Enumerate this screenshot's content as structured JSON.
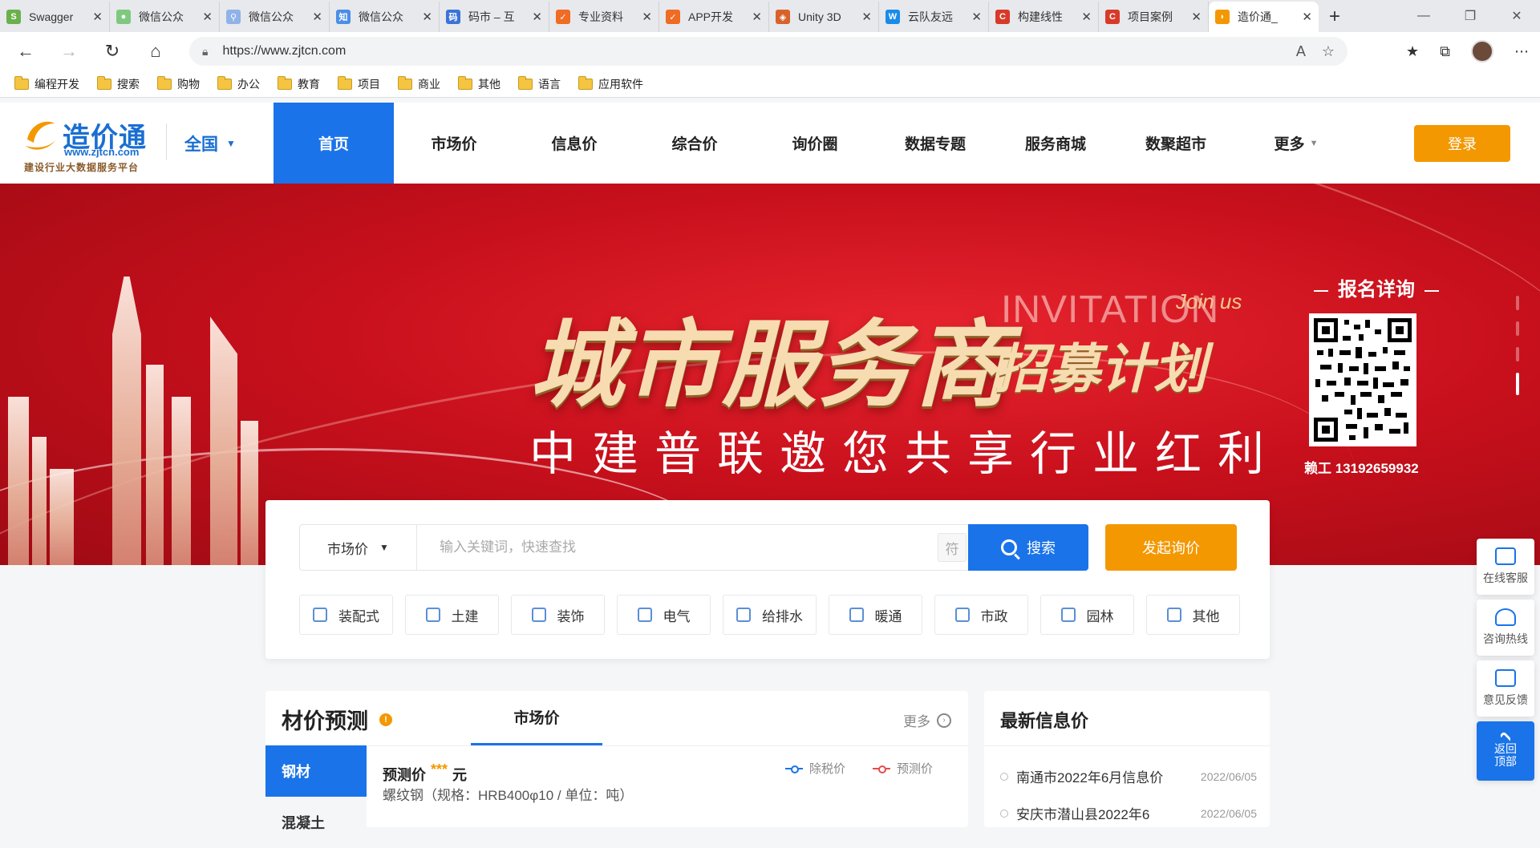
{
  "browser": {
    "tabs": [
      {
        "label": "Swagger",
        "icon": "swagger-icon",
        "color": "#6ab04c"
      },
      {
        "label": "微信公众",
        "icon": "wechat-icon",
        "color": "#7fc97f"
      },
      {
        "label": "微信公众",
        "icon": "search-icon",
        "color": "#8fb3e8"
      },
      {
        "label": "微信公众",
        "icon": "zhihu-icon",
        "color": "#4a8ee8"
      },
      {
        "label": "码市 – 互",
        "icon": "mashi-icon",
        "color": "#3a73d8"
      },
      {
        "label": "专业资料",
        "icon": "check-icon",
        "color": "#f06b24"
      },
      {
        "label": "APP开发",
        "icon": "check-icon",
        "color": "#f06b24"
      },
      {
        "label": "Unity 3D",
        "icon": "unity-icon",
        "color": "#d8622a"
      },
      {
        "label": "云队友远",
        "icon": "yunduiyou-icon",
        "color": "#1a8ce8"
      },
      {
        "label": "构建线性",
        "icon": "csdn-icon",
        "color": "#d83a2a"
      },
      {
        "label": "项目案例",
        "icon": "csdn-icon",
        "color": "#d83a2a"
      },
      {
        "label": "造价通_",
        "icon": "zjtcn-icon",
        "color": "#f39800"
      }
    ],
    "url": "https://www.zjtcn.com",
    "bookmarks": [
      "编程开发",
      "搜索",
      "购物",
      "办公",
      "教育",
      "项目",
      "商业",
      "其他",
      "语言",
      "应用软件"
    ]
  },
  "header": {
    "logo_cn": "造价通",
    "logo_en": "www.zjtcn.com",
    "logo_slogan": "建设行业大数据服务平台",
    "region": "全国",
    "nav": [
      "首页",
      "市场价",
      "信息价",
      "综合价",
      "询价圈",
      "数据专题",
      "服务商城",
      "数聚超市",
      "更多"
    ],
    "login": "登录",
    "accent": "#1a73e8",
    "orange": "#f39800"
  },
  "banner": {
    "title": "城市服务商",
    "invitation": "INVITATION",
    "join": "Join us",
    "plan": "招募计划",
    "subtitle": "中建普联邀您共享行业红利",
    "signup": "报名详询",
    "phone": "赖工 13192659932"
  },
  "search": {
    "type": "市场价",
    "placeholder": "输入关键词，快速查找",
    "symbol": "符",
    "button": "搜索",
    "inquiry": "发起询价",
    "categories": [
      "装配式",
      "土建",
      "装饰",
      "电气",
      "给排水",
      "暖通",
      "市政",
      "园林",
      "其他"
    ]
  },
  "forecast": {
    "title": "材价预测",
    "tab": "市场价",
    "more": "更多",
    "side": [
      "钢材",
      "混凝土"
    ],
    "label": "预测价",
    "stars": "***",
    "unit": "元",
    "spec": "螺纹钢（规格：HRB400φ10 / 单位：吨）",
    "legend": [
      {
        "label": "除税价",
        "color": "#1a73e8"
      },
      {
        "label": "预测价",
        "color": "#e84a4a"
      }
    ]
  },
  "news": {
    "title": "最新信息价",
    "items": [
      {
        "title": "南通市2022年6月信息价",
        "date": "2022/06/05"
      },
      {
        "title": "安庆市潜山县2022年6",
        "date": "2022/06/05"
      }
    ]
  },
  "sidetools": [
    "在线客服",
    "咨询热线",
    "意见反馈",
    "返回",
    "顶部"
  ]
}
